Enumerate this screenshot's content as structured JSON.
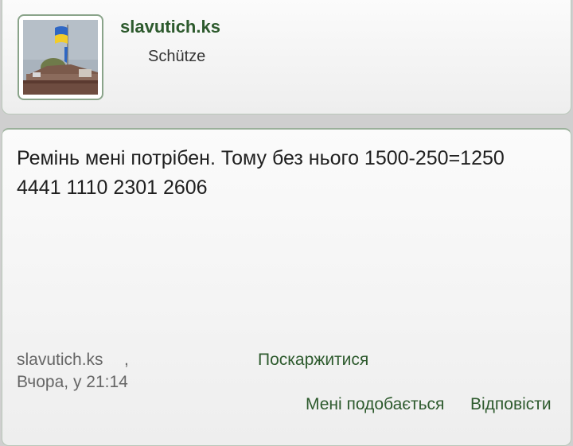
{
  "profile": {
    "username": "slavutich.ks",
    "rank": "Schütze"
  },
  "post": {
    "text_lines": [
      "Ремінь мені потрібен. Тому без нього 1500-250=1250",
      "4441 1110 2301 2606"
    ],
    "author": "slavutich.ks",
    "separator": ",",
    "date": "Вчора, у 21:14"
  },
  "actions": {
    "report_label": "Поскаржитися",
    "like_label": "Мені подобається",
    "reply_label": "Відповісти"
  },
  "colors": {
    "accent": "#2d5a2d",
    "background": "#cfcfcf",
    "card": "#f4f4f4"
  }
}
